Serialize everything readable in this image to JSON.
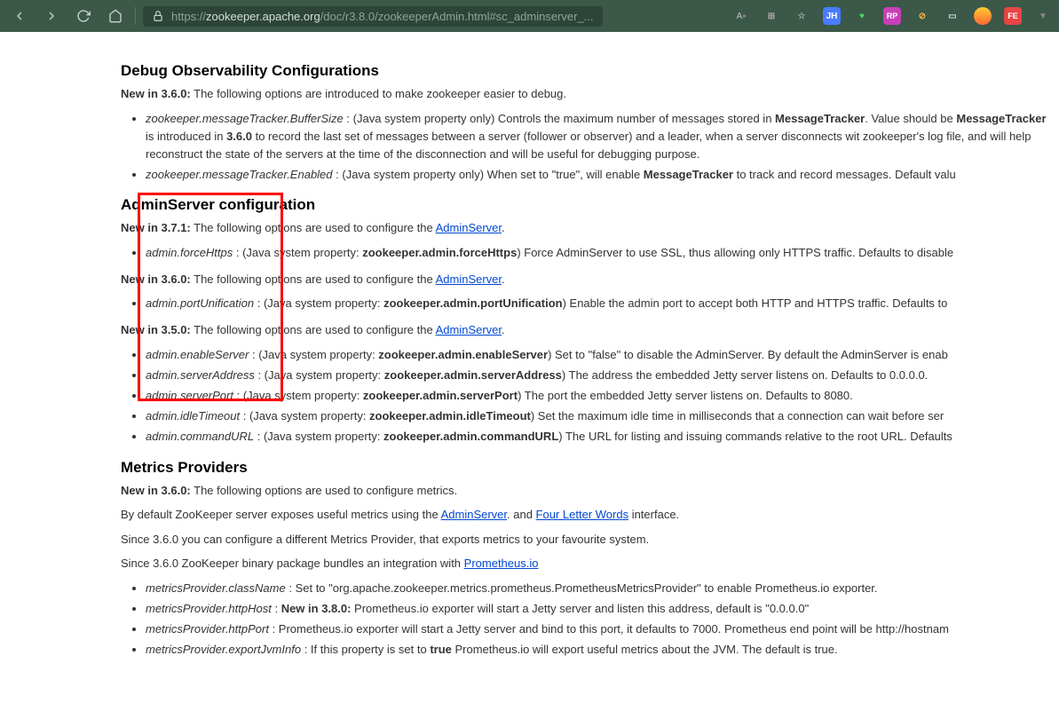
{
  "browser": {
    "url_host": "zookeeper.apache.org",
    "url_path": "/doc/r3.8.0/zookeeperAdmin.html#sc_adminserver_...",
    "url_scheme": "https://"
  },
  "toolbar_badges": {
    "jh": "JH",
    "rp": "RP",
    "fe": "FE"
  },
  "sections": {
    "debug": {
      "title": "Debug Observability Configurations",
      "intro_prefix": "New in 3.6.0:",
      "intro_text": " The following options are introduced to make zookeeper easier to debug.",
      "items": [
        {
          "prop": "zookeeper.messageTracker.BufferSize",
          "body_a": " : (Java system property only) Controls the maximum number of messages stored in ",
          "bold1": "MessageTracker",
          "body_b": ". Value should be ",
          "bold2": "MessageTracker",
          "body_c": " is introduced in ",
          "bold3": "3.6.0",
          "body_d": " to record the last set of messages between a server (follower or observer) and a leader, when a server disconnects wit zookeeper's log file, and will help reconstruct the state of the servers at the time of the disconnection and will be useful for debugging purpose."
        },
        {
          "prop": "zookeeper.messageTracker.Enabled",
          "body_a": " : (Java system property only) When set to \"true\", will enable ",
          "bold1": "MessageTracker",
          "body_b": " to track and record messages. Default valu"
        }
      ]
    },
    "admin": {
      "title": "AdminServer configuration",
      "groups": [
        {
          "prefix": "New in 3.7.1:",
          "text": " The following options are used to configure the ",
          "link": "AdminServer",
          "suffix": ".",
          "items": [
            {
              "prop": "admin.forceHttps",
              "body": " : (Java system property: ",
              "bold": "zookeeper.admin.forceHttps",
              "tail": ") Force AdminServer to use SSL, thus allowing only HTTPS traffic. Defaults to disable"
            }
          ]
        },
        {
          "prefix": "New in 3.6.0:",
          "text": " The following options are used to configure the ",
          "link": "AdminServer",
          "suffix": ".",
          "items": [
            {
              "prop": "admin.portUnification",
              "body": " : (Java system property: ",
              "bold": "zookeeper.admin.portUnification",
              "tail": ") Enable the admin port to accept both HTTP and HTTPS traffic. Defaults to "
            }
          ]
        },
        {
          "prefix": "New in 3.5.0:",
          "text": " The following options are used to configure the ",
          "link": "AdminServer",
          "suffix": ".",
          "items": [
            {
              "prop": "admin.enableServer",
              "body": " : (Java system property: ",
              "bold": "zookeeper.admin.enableServer",
              "tail": ") Set to \"false\" to disable the AdminServer. By default the AdminServer is enab"
            },
            {
              "prop": "admin.serverAddress",
              "body": " : (Java system property: ",
              "bold": "zookeeper.admin.serverAddress",
              "tail": ") The address the embedded Jetty server listens on. Defaults to 0.0.0.0."
            },
            {
              "prop": "admin.serverPort",
              "body": " : (Java system property: ",
              "bold": "zookeeper.admin.serverPort",
              "tail": ") The port the embedded Jetty server listens on. Defaults to 8080."
            },
            {
              "prop": "admin.idleTimeout",
              "body": " : (Java system property: ",
              "bold": "zookeeper.admin.idleTimeout",
              "tail": ") Set the maximum idle time in milliseconds that a connection can wait before ser"
            },
            {
              "prop": "admin.commandURL",
              "body": " : (Java system property: ",
              "bold": "zookeeper.admin.commandURL",
              "tail": ") The URL for listing and issuing commands relative to the root URL. Defaults "
            }
          ]
        }
      ]
    },
    "metrics": {
      "title": "Metrics Providers",
      "intro_prefix": "New in 3.6.0:",
      "intro_text": " The following options are used to configure metrics.",
      "p1_a": "By default ZooKeeper server exposes useful metrics using the ",
      "p1_link1": "AdminServer",
      "p1_b": ". and ",
      "p1_link2": "Four Letter Words",
      "p1_c": " interface.",
      "p2": "Since 3.6.0 you can configure a different Metrics Provider, that exports metrics to your favourite system.",
      "p3_a": "Since 3.6.0 ZooKeeper binary package bundles an integration with ",
      "p3_link": "Prometheus.io",
      "items": [
        {
          "prop": "metricsProvider.className",
          "body": " : Set to \"org.apache.zookeeper.metrics.prometheus.PrometheusMetricsProvider\" to enable Prometheus.io exporter."
        },
        {
          "prop": "metricsProvider.httpHost",
          "body": " : ",
          "bold": "New in 3.8.0:",
          "tail": " Prometheus.io exporter will start a Jetty server and listen this address, default is \"0.0.0.0\""
        },
        {
          "prop": "metricsProvider.httpPort",
          "body": " : Prometheus.io exporter will start a Jetty server and bind to this port, it defaults to 7000. Prometheus end point will be http://hostnam"
        },
        {
          "prop": "metricsProvider.exportJvmInfo",
          "body": " : If this property is set to ",
          "bold": "true",
          "tail": " Prometheus.io will export useful metrics about the JVM. The default is true."
        }
      ]
    }
  }
}
